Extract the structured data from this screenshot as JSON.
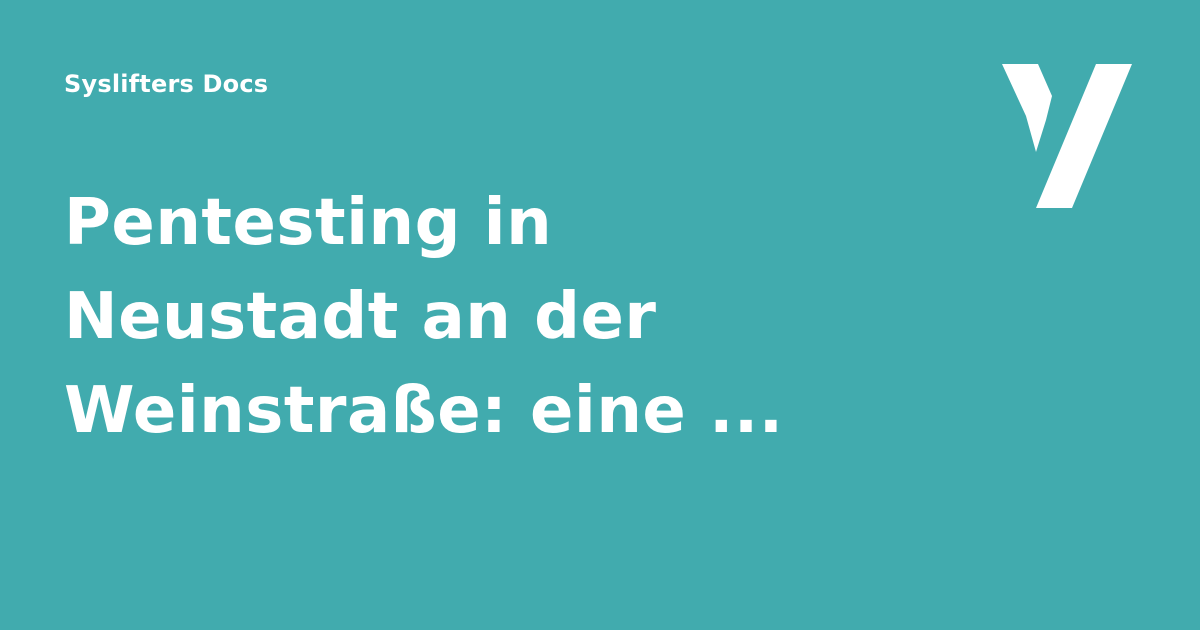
{
  "header": {
    "site_name": "Syslifters Docs"
  },
  "title": {
    "lines": [
      "Pentesting in",
      "Neustadt an der",
      "Weinstraße: eine ..."
    ]
  },
  "logo": {
    "icon": "syslifters-y-logo-icon"
  },
  "colors": {
    "background": "#41abae",
    "foreground": "#ffffff"
  }
}
